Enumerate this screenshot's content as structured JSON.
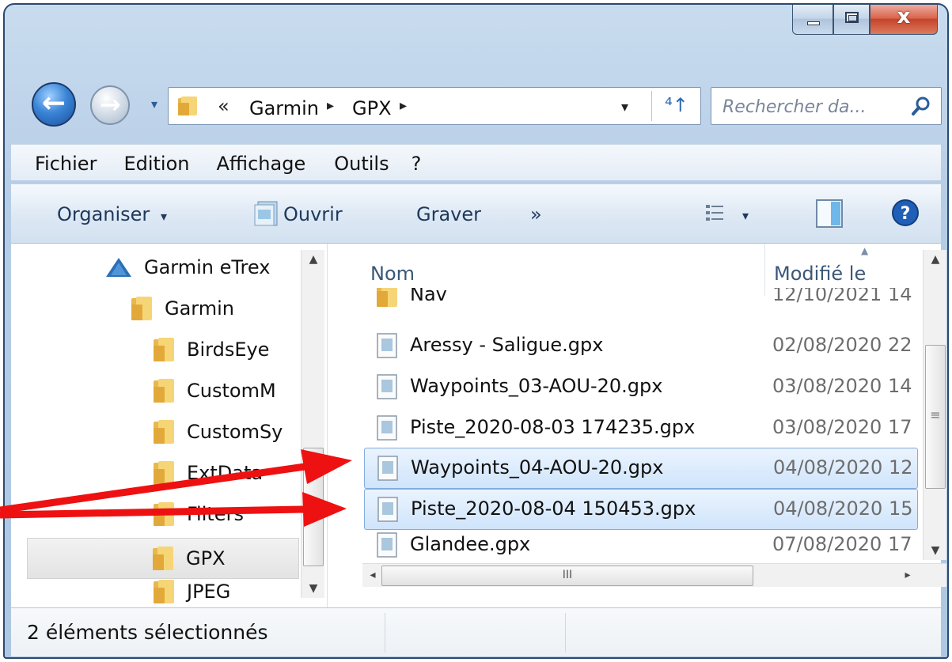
{
  "window": {
    "close_glyph": "x",
    "icons": [
      "minimize-icon",
      "maximize-icon",
      "close-icon"
    ]
  },
  "navigation": {
    "back_glyph": "←",
    "forward_glyph": "→",
    "history_glyph": "▾",
    "chevron": "«",
    "breadcrumb": [
      "Garmin",
      "GPX"
    ],
    "crumb_arrow": "▸",
    "dropdown_glyph": "▾",
    "refresh_glyph": "⁴↑",
    "search_placeholder": "Rechercher da..."
  },
  "menu": {
    "items": [
      "Fichier",
      "Edition",
      "Affichage",
      "Outils",
      "?"
    ]
  },
  "toolbar": {
    "organise_label": "Organiser",
    "organise_arrow": "▾",
    "open_label": "Ouvrir",
    "burn_label": "Graver",
    "more_glyph": "»",
    "view_arrow": "▾"
  },
  "tree": {
    "items": [
      {
        "label": "Garmin eTrex",
        "icon": "drive-icon"
      },
      {
        "label": "Garmin",
        "icon": "folder-icon"
      },
      {
        "label": "BirdsEye",
        "icon": "folder-icon"
      },
      {
        "label": "CustomM",
        "icon": "folder-icon"
      },
      {
        "label": "CustomSy",
        "icon": "folder-icon"
      },
      {
        "label": "ExtData",
        "icon": "folder-icon"
      },
      {
        "label": "Filters",
        "icon": "folder-icon"
      },
      {
        "label": "GPX",
        "icon": "folder-icon",
        "selected": true
      },
      {
        "label": "JPEG",
        "icon": "folder-icon"
      }
    ],
    "scroll_up": "▲",
    "scroll_down": "▼"
  },
  "list": {
    "columns": {
      "name": "Nom",
      "modified": "Modifié le"
    },
    "sort_glyph": "▲",
    "rows": [
      {
        "name": "Nav",
        "date": "12/10/2021 14",
        "icon": "folder-icon"
      },
      {
        "name": "Aressy - Saligue.gpx",
        "date": "02/08/2020 22",
        "icon": "file-icon"
      },
      {
        "name": "Waypoints_03-AOU-20.gpx",
        "date": "03/08/2020 14",
        "icon": "file-icon"
      },
      {
        "name": "Piste_2020-08-03 174235.gpx",
        "date": "03/08/2020 17",
        "icon": "file-icon"
      },
      {
        "name": "Waypoints_04-AOU-20.gpx",
        "date": "04/08/2020 12",
        "icon": "file-icon",
        "selected": true
      },
      {
        "name": "Piste_2020-08-04 150453.gpx",
        "date": "04/08/2020 15",
        "icon": "file-icon",
        "selected": true
      },
      {
        "name": "Glandee.gpx",
        "date": "07/08/2020 17",
        "icon": "file-icon"
      }
    ],
    "hscroll_grip": "III",
    "left_arrow": "◂",
    "right_arrow": "▸",
    "v_up": "▲",
    "v_down": "▼",
    "v_grip": "≡"
  },
  "status": {
    "text": "2 éléments sélectionnés"
  },
  "colors": {
    "frame": "#aec7e2",
    "selection": "#cfe4fb",
    "annotation_arrow": "#ee1111"
  }
}
